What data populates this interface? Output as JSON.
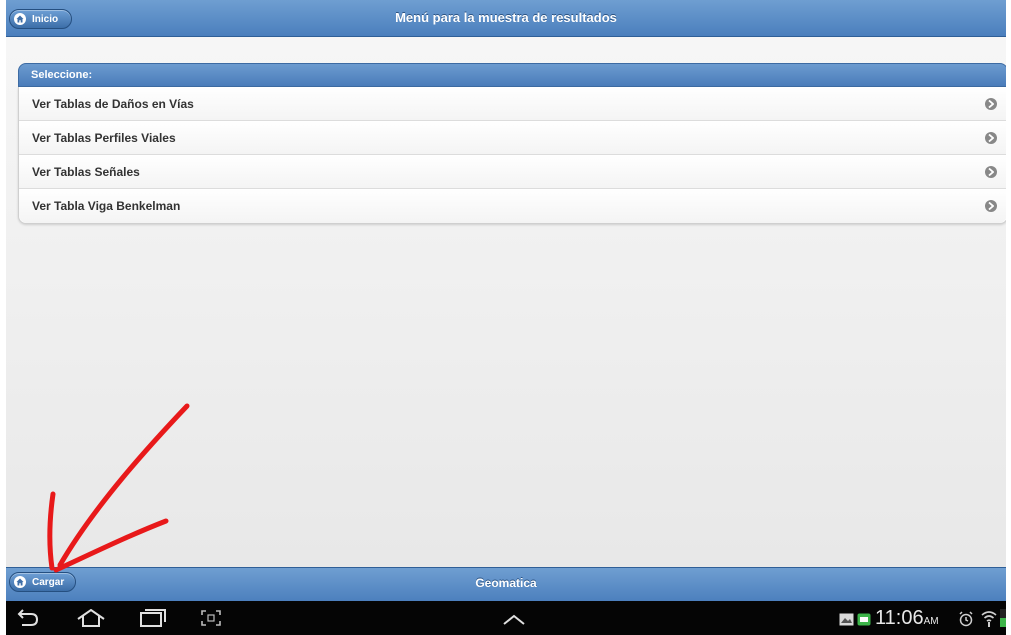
{
  "header": {
    "title": "Menú para la muestra de resultados",
    "home_button": "Inicio"
  },
  "list": {
    "header": "Seleccione:",
    "items": [
      {
        "label": "Ver Tablas de Daños en Vías"
      },
      {
        "label": "Ver Tablas Perfiles Viales"
      },
      {
        "label": "Ver Tablas Señales"
      },
      {
        "label": "Ver Tabla Viga Benkelman"
      }
    ]
  },
  "footer": {
    "title": "Geomatica",
    "load_button": "Cargar"
  },
  "system_bar": {
    "time": "11:06",
    "ampm": "AM"
  },
  "colors": {
    "bar_blue": "#4b7fbd",
    "annotation_red": "#e8191a"
  }
}
